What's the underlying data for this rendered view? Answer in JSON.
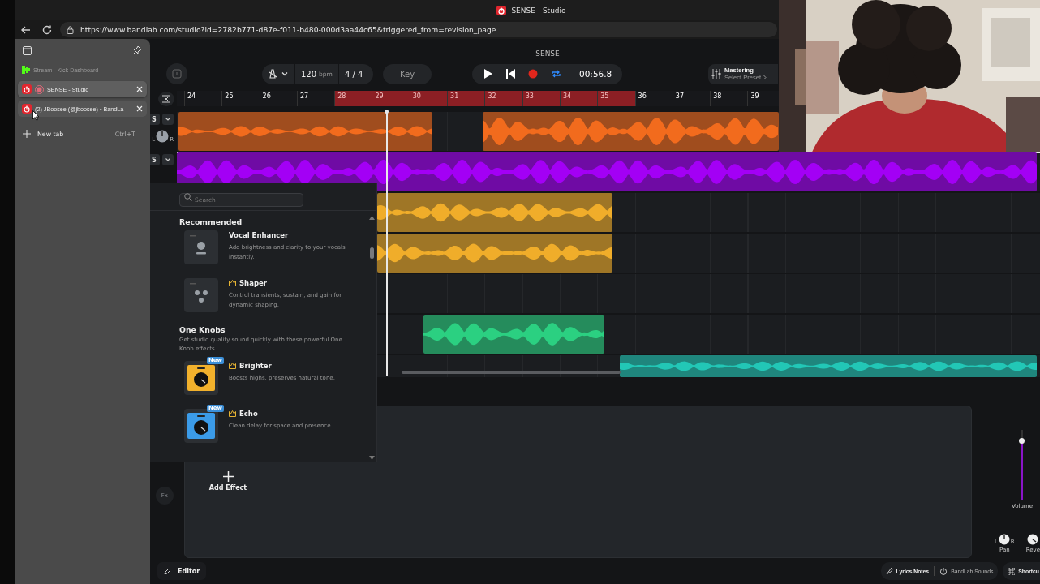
{
  "window": {
    "title": "SENSE - Studio"
  },
  "address_bar": {
    "url": "https://www.bandlab.com/studio?id=2782b771-d87e-f011-b480-000d3aa44c65&triggered_from=revision_page"
  },
  "tab_panel": {
    "tabs": [
      {
        "title": "Stream - Kick Dashboard",
        "kind": "kick",
        "selected": false,
        "hovered": false,
        "faded": true,
        "recording": false,
        "closable": false
      },
      {
        "title": "SENSE - Studio",
        "kind": "bandlab",
        "selected": true,
        "hovered": false,
        "faded": false,
        "recording": true,
        "closable": true
      },
      {
        "title": "(2) JBoosee (@jboosee) • BandLa",
        "kind": "bandlab",
        "selected": false,
        "hovered": true,
        "faded": false,
        "recording": false,
        "closable": true
      }
    ],
    "new_tab": {
      "label": "New tab",
      "shortcut": "Ctrl+T"
    }
  },
  "project": {
    "title": "SENSE"
  },
  "toolbar": {
    "tempo": "120",
    "tempo_unit": "bpm",
    "time_signature": "4 / 4",
    "key_button": "Key",
    "time": "00:56.8",
    "loop_on": true,
    "mastering": {
      "label": "Mastering",
      "preset": "Select Preset"
    }
  },
  "ruler": {
    "bars": [
      {
        "label": "24",
        "looped": false
      },
      {
        "label": "25",
        "looped": false
      },
      {
        "label": "26",
        "looped": false
      },
      {
        "label": "27",
        "looped": false
      },
      {
        "label": "28",
        "looped": true
      },
      {
        "label": "29",
        "looped": true
      },
      {
        "label": "30",
        "looped": true
      },
      {
        "label": "31",
        "looped": true
      },
      {
        "label": "32",
        "looped": true
      },
      {
        "label": "33",
        "looped": true
      },
      {
        "label": "34",
        "looped": true
      },
      {
        "label": "35",
        "looped": true
      },
      {
        "label": "36",
        "looped": false
      },
      {
        "label": "37",
        "looped": false
      },
      {
        "label": "38",
        "looped": false
      },
      {
        "label": "39",
        "looped": false
      }
    ]
  },
  "tracks": [
    {
      "color": "#f26b1d",
      "selected": false,
      "solo": "S",
      "pan": {
        "left": "L",
        "right": "R"
      }
    },
    {
      "color": "#a300f5",
      "selected": true,
      "solo": "S"
    },
    {
      "color": "#f0ad2a",
      "selected": false
    },
    {
      "color": "#f0ad2a",
      "selected": false
    },
    {
      "selected": false
    },
    {
      "color": "#2bd081",
      "selected": false
    },
    {
      "color": "#22c7b6",
      "selected": false
    }
  ],
  "effects_popup": {
    "search_placeholder": "Search",
    "sections": [
      {
        "title": "Recommended",
        "effects": [
          {
            "name": "Vocal Enhancer",
            "description": "Add brightness and clarity to your vocals instantly.",
            "kind": "enhancer",
            "premium": false
          },
          {
            "name": "Shaper",
            "description": "Control transients, sustain, and gain for dynamic shaping.",
            "kind": "shaper",
            "premium": true
          }
        ]
      },
      {
        "title": "One Knobs",
        "description": "Get studio quality sound quickly with these powerful One Knob effects.",
        "effects": [
          {
            "name": "Brighter",
            "description": "Boosts highs, preserves natural tone.",
            "kind": "one_knob",
            "color": "#f2b12c",
            "badge": "New",
            "premium": true
          },
          {
            "name": "Echo",
            "description": "Clean delay for space and presence.",
            "kind": "one_knob",
            "color": "#3b9be8",
            "badge": "New",
            "premium": true
          }
        ]
      }
    ]
  },
  "lower_panel": {
    "add_effect": "Add Effect",
    "fx_button": "Fx",
    "volume": {
      "label": "Volume",
      "level": 0.84
    },
    "pan": {
      "label": "Pan",
      "left": "L",
      "right": "R"
    },
    "reverb": {
      "label": "Reve"
    }
  },
  "bottom_bar": {
    "editor": "Editor",
    "lyrics": "Lyrics/Notes",
    "sounds": "BandLab Sounds",
    "shortcuts": "Shortcu"
  }
}
